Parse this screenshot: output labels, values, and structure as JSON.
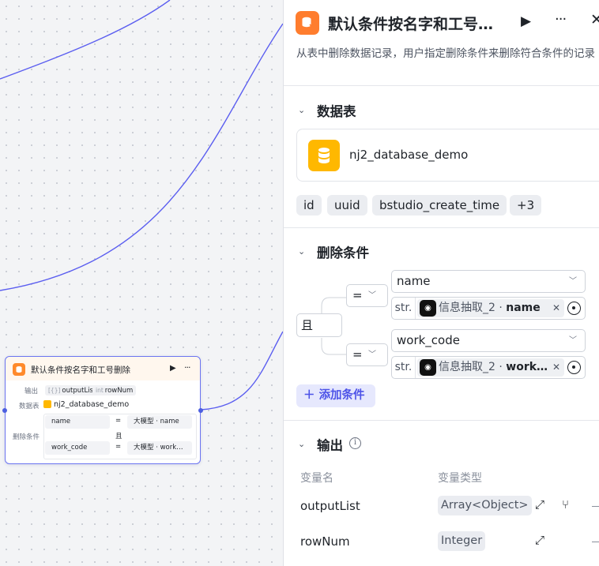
{
  "canvas_node": {
    "title": "默认条件按名字和工号删除",
    "output_label": "输出",
    "outputs": [
      {
        "type": "[{}]",
        "name": "outputList"
      },
      {
        "type": "int",
        "name": "rowNum"
      }
    ],
    "table_label": "数据表",
    "table_name": "nj2_database_demo",
    "delete_label": "删除条件",
    "conditions": [
      {
        "field": "name",
        "op": "=",
        "value": "大模型 · name"
      },
      {
        "field": "work_code",
        "op": "=",
        "value": "大模型 · work…"
      }
    ],
    "logic": "且"
  },
  "panel": {
    "title": "默认条件按名字和工号…",
    "description": "从表中删除数据记录，用户指定删除条件来删除符合条件的记录",
    "database_section": {
      "title": "数据表",
      "db_name": "nj2_database_demo",
      "columns": [
        "id",
        "uuid",
        "bstudio_create_time",
        "+3"
      ]
    },
    "delete_section": {
      "title": "删除条件",
      "logic": "且",
      "conditions": [
        {
          "op": "=",
          "field": "name",
          "value_type": "str.",
          "ref_node": "信息抽取_2 · ",
          "ref_var": "name"
        },
        {
          "op": "=",
          "field": "work_code",
          "value_type": "str.",
          "ref_node": "信息抽取_2 · ",
          "ref_var": "work…"
        }
      ],
      "add_button": "添加条件"
    },
    "output_section": {
      "title": "输出",
      "col_name": "变量名",
      "col_type": "变量类型",
      "rows": [
        {
          "name": "outputList",
          "type": "Array<Object>"
        },
        {
          "name": "rowNum",
          "type": "Integer"
        }
      ]
    }
  },
  "colors": {
    "accent": "#4d53e8",
    "edge": "#5b5ef0",
    "node_icon": "#ff7d2e",
    "db_icon": "#ffb800"
  }
}
